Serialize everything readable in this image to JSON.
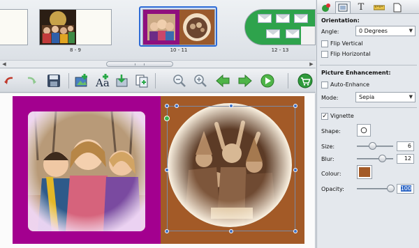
{
  "strip": {
    "labels": [
      "8 - 9",
      "10 - 11",
      "12 - 13"
    ],
    "selected_index": 1
  },
  "toolbar": {
    "icons": [
      "undo-icon",
      "redo-icon",
      "save-icon",
      "add-photo-icon",
      "add-text-icon",
      "import-icon",
      "copy-page-icon",
      "zoom-out-icon",
      "zoom-in-icon",
      "back-arrow-icon",
      "forward-arrow-icon",
      "play-icon",
      "cart-icon"
    ]
  },
  "panel": {
    "tabs": [
      "effects-tab",
      "frame-tab",
      "text-tab",
      "ruler-tab",
      "page-tab"
    ],
    "orientation_title": "Orientation:",
    "angle_label": "Angle:",
    "angle_value": "0 Degrees",
    "flip_vertical": "Flip Vertical",
    "flip_horizontal": "Flip Horizontal",
    "enhancement_title": "Picture Enhancement:",
    "auto_enhance": "Auto-Enhance",
    "mode_label": "Mode:",
    "mode_value": "Sepia",
    "vignette_label": "Vignette",
    "vignette_checked": true,
    "shape_label": "Shape:",
    "size_label": "Size:",
    "size_value": "6",
    "blur_label": "Blur:",
    "blur_value": "12",
    "colour_label": "Colour:",
    "colour_value": "#a35a27",
    "opacity_label": "Opacity:",
    "opacity_value": "100"
  },
  "colors": {
    "left_page": "#a3008f",
    "right_page": "#a35a27",
    "selection": "#2d6bd6"
  }
}
